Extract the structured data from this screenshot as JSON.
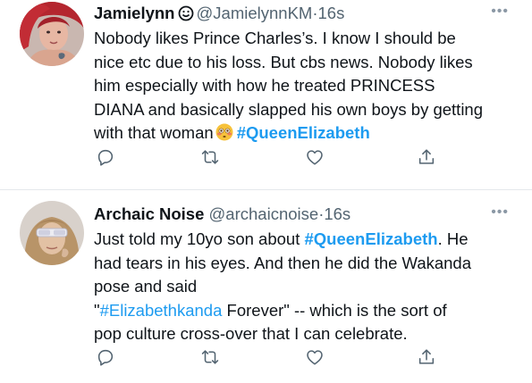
{
  "tweets": [
    {
      "author_name": "Jamielynn",
      "handle": "@JamielynnKM",
      "separator": "·",
      "time": "16s",
      "text_lines": [
        "Nobody likes Prince Charles’s. I know I should be",
        "nice etc due to his loss. But cbs news. Nobody likes",
        "him especially with how he treated PRINCESS",
        "DIANA and basically slapped his own boys by getting"
      ],
      "line5_text": "with that woman",
      "line5_hashtag": "#QueenElizabeth",
      "more_label": "•••",
      "icons": {
        "reply": "reply-icon",
        "retweet": "retweet-icon",
        "like": "like-icon",
        "share": "share-icon",
        "emoji": "flushed-face-emoji",
        "verified": "smiley-badge-icon"
      }
    },
    {
      "author_name": "Archaic Noise",
      "handle": "@archaicnoise",
      "separator": "·",
      "time": "16s",
      "line1_pre": "Just told my 10yo son about",
      "line1_hashtag": "#QueenElizabeth",
      "line1_post": ". He",
      "line2": "had tears in his eyes. And then he did the Wakanda",
      "line3": "pose and said",
      "line4_quote_open": "\"",
      "line4_hashtag": "#Elizabethkanda",
      "line4_post": " Forever\" -- which is the sort of",
      "line5": "pop culture cross-over that I can celebrate.",
      "more_label": "•••",
      "icons": {
        "reply": "reply-icon",
        "retweet": "retweet-icon",
        "like": "like-icon",
        "share": "share-icon"
      }
    }
  ],
  "colors": {
    "link": "#1d9bf0",
    "secondary_text": "#536471",
    "icon": "#536471",
    "divider": "#e4e8eb"
  }
}
